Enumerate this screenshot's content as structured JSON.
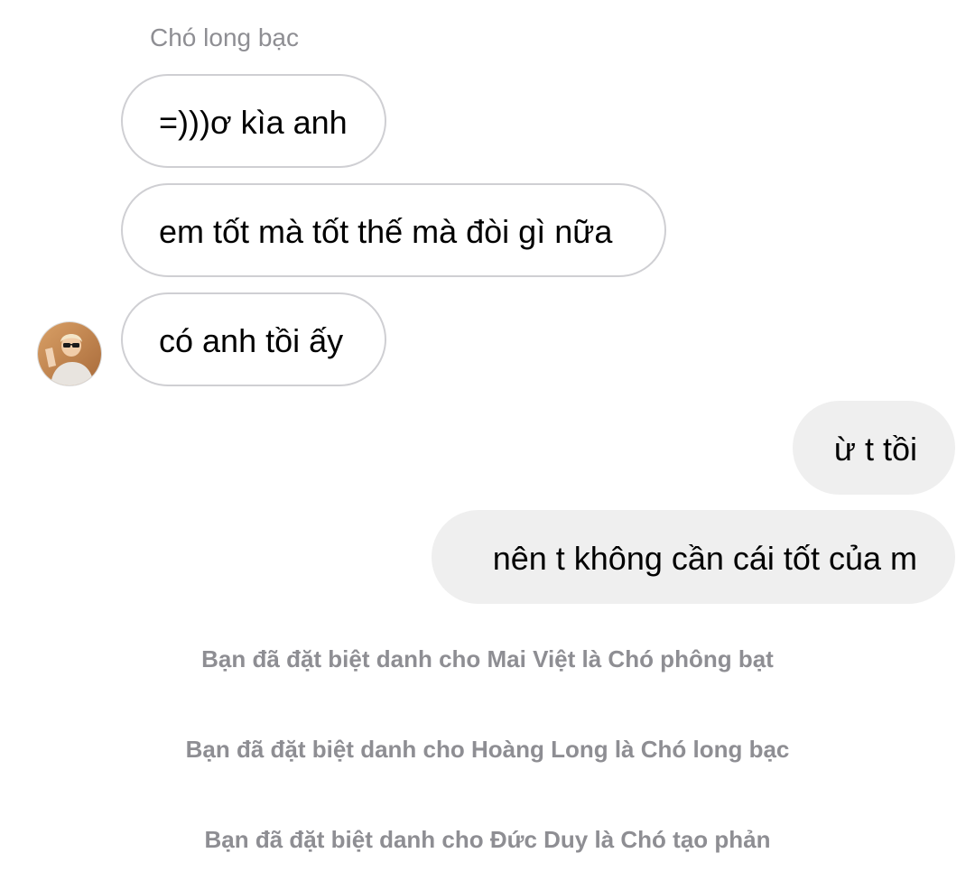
{
  "conversation": {
    "sender_name": "Chó long bạc",
    "incoming": [
      {
        "text": "=)))ơ kìa anh"
      },
      {
        "text": "em tốt mà tốt thế mà đòi gì nữa"
      },
      {
        "text": "có anh tồi ấy"
      }
    ],
    "outgoing": [
      {
        "text": "ừ t tồi"
      },
      {
        "text": "nên t không cần cái tốt của m"
      }
    ],
    "system_notes": [
      {
        "text": "Bạn đã đặt biệt danh cho Mai Việt là Chó phông bạt"
      },
      {
        "text": "Bạn đã đặt biệt danh cho Hoàng Long là Chó long bạc"
      },
      {
        "text": "Bạn đã đặt biệt danh cho Đức Duy là Chó tạo phản"
      }
    ]
  },
  "colors": {
    "incoming_border": "#cfcfd3",
    "outgoing_bubble": "#efefef",
    "meta_text": "#8e8e93"
  },
  "icons": {
    "avatar": "user-avatar-photo"
  }
}
